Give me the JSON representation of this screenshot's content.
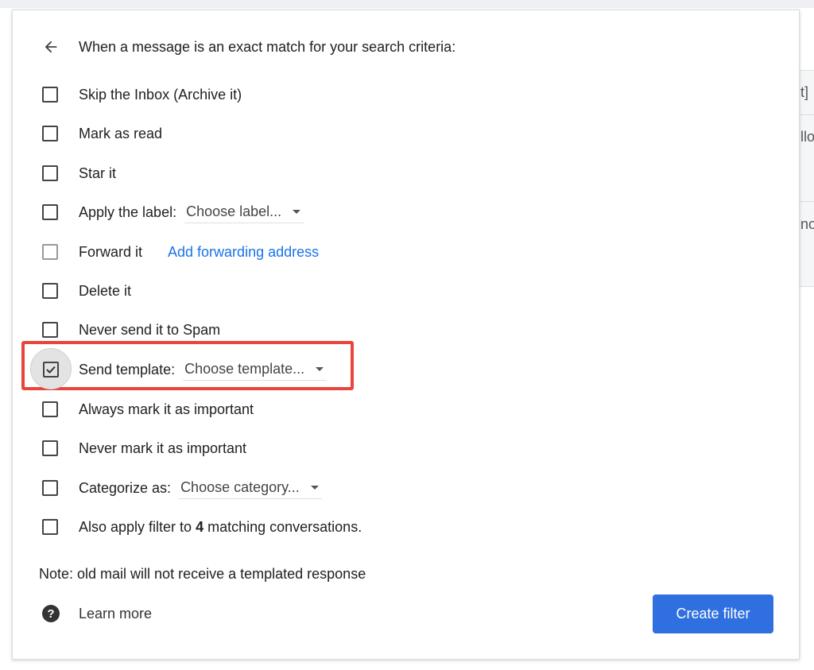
{
  "header": {
    "title": "When a message is an exact match for your search criteria:"
  },
  "options": [
    {
      "label": "Skip the Inbox (Archive it)",
      "checked": false
    },
    {
      "label": "Mark as read",
      "checked": false
    },
    {
      "label": "Star it",
      "checked": false
    },
    {
      "label": "Apply the label:",
      "select": "Choose label...",
      "checked": false
    },
    {
      "label": "Forward it",
      "link": "Add forwarding address",
      "checked": false
    },
    {
      "label": "Delete it",
      "checked": false
    },
    {
      "label": "Never send it to Spam",
      "checked": false
    },
    {
      "label": "Send template:",
      "select": "Choose template...",
      "checked": true
    },
    {
      "label": "Always mark it as important",
      "checked": false
    },
    {
      "label": "Never mark it as important",
      "checked": false
    },
    {
      "label": "Categorize as:",
      "select": "Choose category...",
      "checked": false
    }
  ],
  "apply": {
    "prefix": "Also apply filter to ",
    "count": "4",
    "suffix": " matching conversations."
  },
  "note": "Note: old mail will not receive a templated response",
  "learn_more": "Learn more",
  "create_filter": "Create filter",
  "background": {
    "t1": "t]",
    "t2": "llo",
    "t3": "no"
  },
  "colors": {
    "accent": "#2f6fe0",
    "highlight": "#e8453c",
    "link": "#1a73e8"
  }
}
